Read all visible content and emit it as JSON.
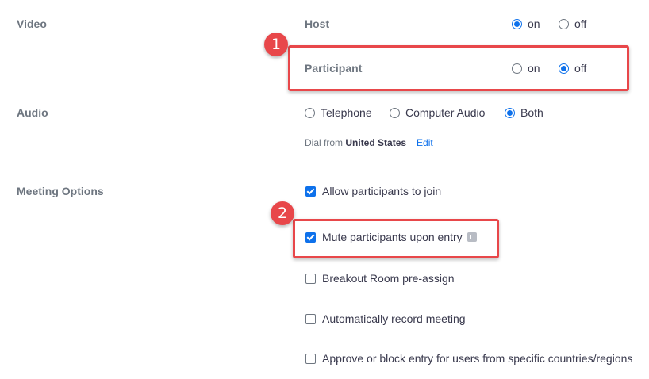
{
  "settings": {
    "video": {
      "label": "Video",
      "host": {
        "label": "Host",
        "on": "on",
        "off": "off",
        "selected": "on"
      },
      "participant": {
        "label": "Participant",
        "on": "on",
        "off": "off",
        "selected": "off"
      }
    },
    "audio": {
      "label": "Audio",
      "options": [
        "Telephone",
        "Computer Audio",
        "Both"
      ],
      "selected": "Both",
      "dial_prefix": "Dial from",
      "dial_country": "United States",
      "edit_link": "Edit"
    },
    "meeting_options": {
      "label": "Meeting Options",
      "items": [
        {
          "label": "Allow participants to join",
          "checked": true
        },
        {
          "label": "Mute participants upon entry",
          "checked": true
        },
        {
          "label": "Breakout Room pre-assign",
          "checked": false
        },
        {
          "label": "Automatically record meeting",
          "checked": false
        },
        {
          "label": "Approve or block entry for users from specific countries/regions",
          "checked": false
        }
      ]
    }
  },
  "callouts": {
    "one": "1",
    "two": "2"
  },
  "colors": {
    "accent": "#0e71eb",
    "callout": "#e8474a"
  }
}
